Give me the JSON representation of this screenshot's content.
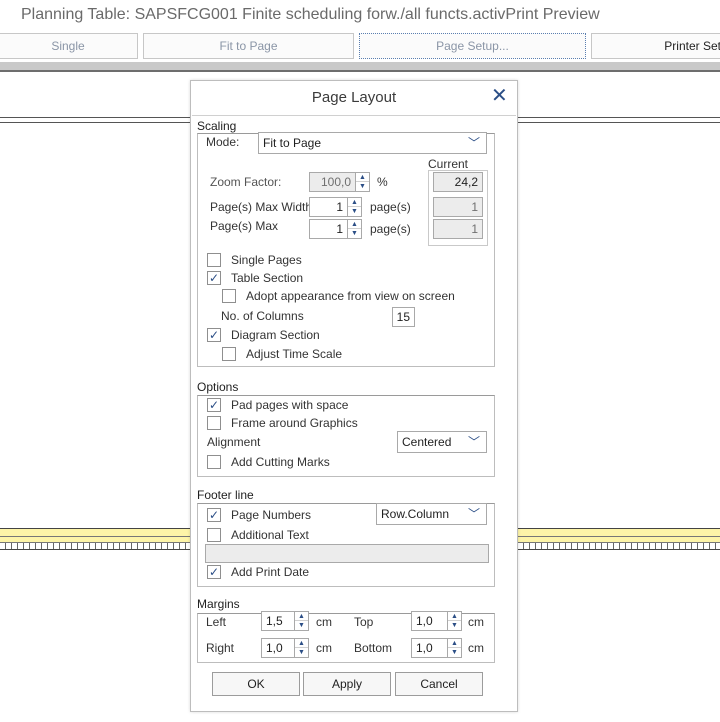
{
  "window": {
    "title": "Planning Table: SAPSFCG001 Finite scheduling forw./all functs.activPrint Preview"
  },
  "toolbar": {
    "single": "Single",
    "fit_to_page": "Fit to Page",
    "page_setup": "Page Setup...",
    "printer_settings": "Printer Set"
  },
  "dialog": {
    "title": "Page Layout",
    "close_icon": "close-icon",
    "scaling": {
      "group_label": "Scaling",
      "mode_label": "Mode:",
      "mode_value": "Fit to Page",
      "current_label": "Current",
      "zoom_label": "Zoom Factor:",
      "zoom_value": "100,0",
      "zoom_unit": "%",
      "zoom_current": "24,2",
      "max_width_label": "Page(s) Max Width",
      "max_width_value": "1",
      "max_width_unit": "page(s)",
      "max_width_current": "1",
      "max_label": "Page(s) Max",
      "max_value": "1",
      "max_unit": "page(s)",
      "max_current": "1",
      "single_pages": {
        "label": "Single Pages",
        "checked": false
      },
      "table_section": {
        "label": "Table Section",
        "checked": true
      },
      "adopt_appearance": {
        "label": "Adopt appearance from view on screen",
        "checked": false
      },
      "columns_label": "No. of Columns",
      "columns_value": "15",
      "diagram_section": {
        "label": "Diagram Section",
        "checked": true
      },
      "adjust_time_scale": {
        "label": "Adjust Time Scale",
        "checked": false
      }
    },
    "options": {
      "group_label": "Options",
      "pad_pages": {
        "label": "Pad pages with space",
        "checked": true
      },
      "frame_graphics": {
        "label": "Frame around Graphics",
        "checked": false
      },
      "alignment_label": "Alignment",
      "alignment_value": "Centered",
      "cutting_marks": {
        "label": "Add Cutting Marks",
        "checked": false
      }
    },
    "footer": {
      "group_label": "Footer line",
      "page_numbers": {
        "label": "Page Numbers",
        "checked": true
      },
      "page_numbers_format": "Row.Column",
      "additional_text": {
        "label": "Additional Text",
        "checked": false
      },
      "additional_text_value": "",
      "print_date": {
        "label": "Add Print Date",
        "checked": true
      }
    },
    "margins": {
      "group_label": "Margins",
      "left_label": "Left",
      "left_value": "1,5",
      "top_label": "Top",
      "top_value": "1,0",
      "right_label": "Right",
      "right_value": "1,0",
      "bottom_label": "Bottom",
      "bottom_value": "1,0",
      "unit": "cm"
    },
    "buttons": {
      "ok": "OK",
      "apply": "Apply",
      "cancel": "Cancel"
    }
  },
  "colors": {
    "accent": "#2b4e86",
    "preview_yellow": "#fdf4a8"
  }
}
